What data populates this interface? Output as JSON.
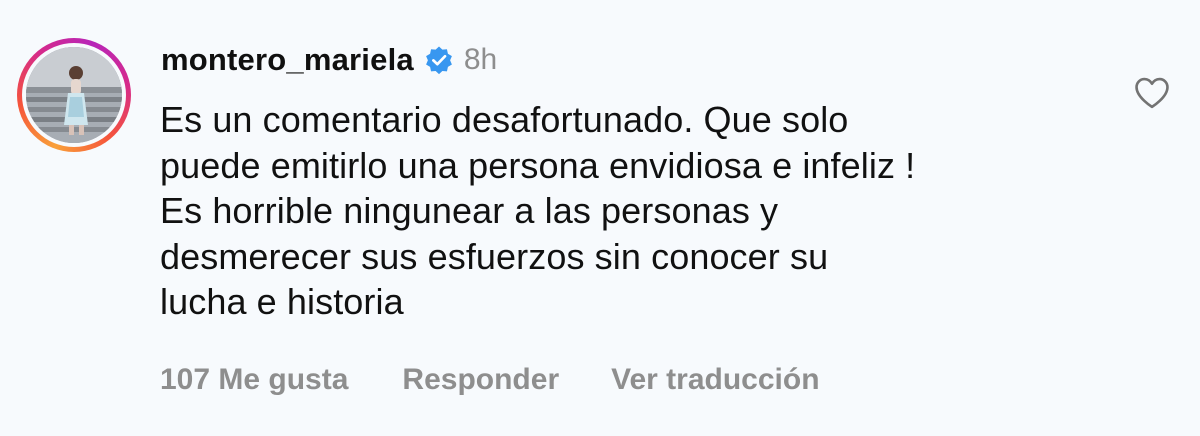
{
  "comment": {
    "username": "montero_mariela",
    "verified": true,
    "time": "8h",
    "text": "Es un comentario desafortunado. Que solo\npuede emitirlo una persona envidiosa e infeliz !\nEs horrible ningunear a las personas y\ndesmerecer sus esfuerzos sin conocer su\nlucha e historia",
    "likes_label": "107 Me gusta",
    "reply_label": "Responder",
    "translate_label": "Ver traducción"
  },
  "colors": {
    "background": "#f7fafd",
    "verified_badge": "#3897f0",
    "muted_text": "#8e8e8e"
  },
  "icons": {
    "like": "heart-outline-icon",
    "verified": "verified-badge-icon"
  }
}
